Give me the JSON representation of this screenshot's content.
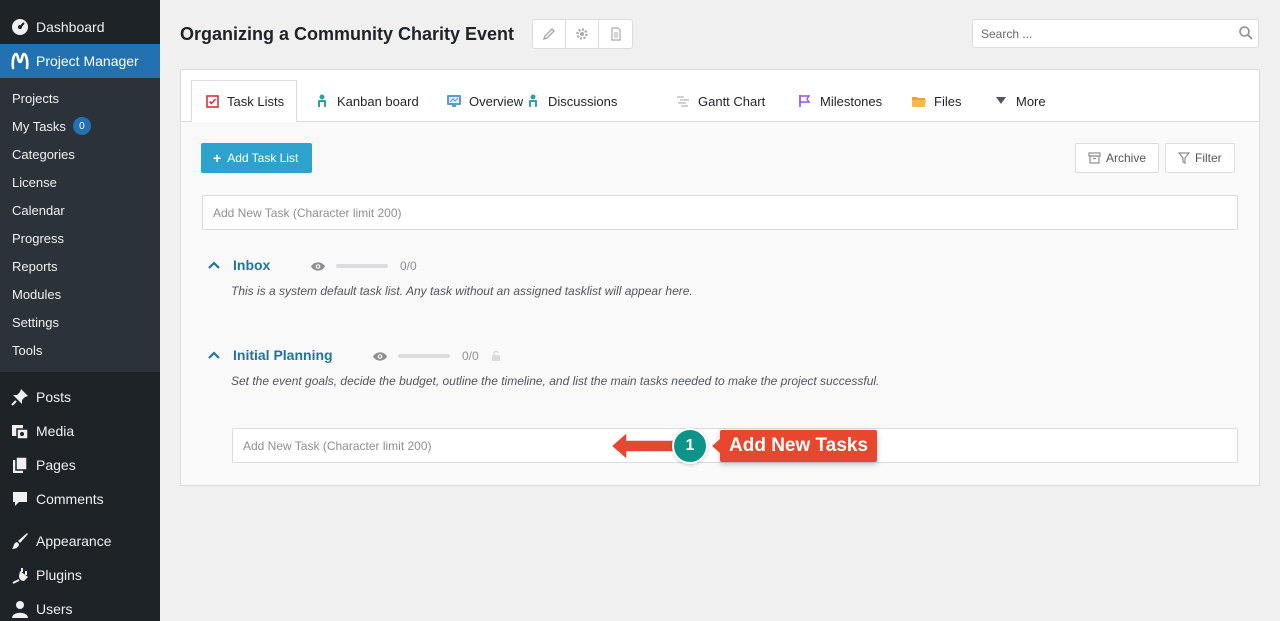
{
  "sidebar": {
    "dashboard": "Dashboard",
    "project_manager": "Project Manager",
    "submenu": {
      "projects": "Projects",
      "my_tasks": "My Tasks",
      "my_tasks_count": "0",
      "categories": "Categories",
      "license": "License",
      "calendar": "Calendar",
      "progress": "Progress",
      "reports": "Reports",
      "modules": "Modules",
      "settings": "Settings",
      "tools": "Tools"
    },
    "posts": "Posts",
    "media": "Media",
    "pages": "Pages",
    "comments": "Comments",
    "appearance": "Appearance",
    "plugins": "Plugins",
    "users": "Users"
  },
  "header": {
    "title": "Organizing a Community Charity Event",
    "search_placeholder": "Search ..."
  },
  "tabs": {
    "task_lists": "Task Lists",
    "kanban": "Kanban board",
    "overview": "Overview",
    "discussions": "Discussions",
    "gantt": "Gantt Chart",
    "milestones": "Milestones",
    "files": "Files",
    "more": "More"
  },
  "toolbar": {
    "add_task_list": "Add Task List",
    "archive": "Archive",
    "filter": "Filter"
  },
  "task_input_placeholder": "Add New Task (Character limit 200)",
  "lists": {
    "inbox": {
      "title": "Inbox",
      "count": "0/0",
      "progress": 0,
      "description": "This is a system default task list. Any task without an assigned tasklist will appear here."
    },
    "initial": {
      "title": "Initial Planning",
      "count": "0/0",
      "progress": 0,
      "description": "Set the event goals, decide the budget, outline the timeline, and list the main tasks needed to make the project successful.",
      "task_placeholder": "Add New Task (Character limit 200)"
    }
  },
  "annotation": {
    "step": "1",
    "label": "Add New Tasks",
    "colors": {
      "label": "#e8472f",
      "circle": "#0d9488"
    }
  }
}
